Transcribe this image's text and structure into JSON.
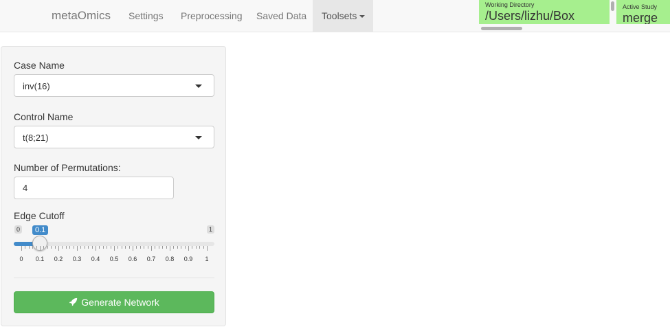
{
  "navbar": {
    "brand": "metaOmics",
    "items": [
      "Settings",
      "Preprocessing",
      "Saved Data",
      "Toolsets"
    ],
    "working_directory": {
      "label": "Working Directory",
      "value": "/Users/lizhu/Box"
    },
    "active_study": {
      "label": "Active Study",
      "value": "merge"
    }
  },
  "form": {
    "case_name": {
      "label": "Case Name",
      "value": "inv(16)"
    },
    "control_name": {
      "label": "Control Name",
      "value": "t(8;21)"
    },
    "permutations": {
      "label": "Number of Permutations:",
      "value": "4"
    },
    "edge_cutoff": {
      "label": "Edge Cutoff",
      "min": "0",
      "max": "1",
      "value": "0.1",
      "level": 0.1,
      "tick_labels": [
        "0",
        "0.1",
        "0.2",
        "0.3",
        "0.4",
        "0.5",
        "0.6",
        "0.7",
        "0.8",
        "0.9",
        "1"
      ]
    },
    "generate_button": "Generate Network"
  },
  "colors": {
    "accent_blue": "#428bca",
    "button_green": "#5cb85c",
    "status_green": "#a6ef8e"
  },
  "icons": {
    "generate": "rocket-icon",
    "dropdown": "caret-down-icon"
  }
}
